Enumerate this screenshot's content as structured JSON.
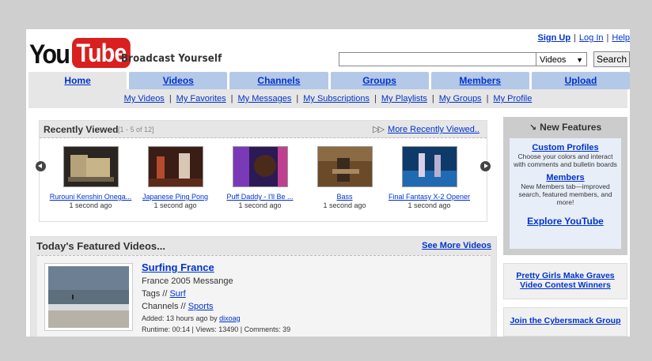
{
  "header": {
    "logo_left": "You",
    "logo_right": "Tube",
    "tagline": "Broadcast Yourself",
    "top_links": [
      "Sign Up",
      "Log In",
      "Help"
    ],
    "search": {
      "value": "",
      "select_value": "Videos",
      "button_label": "Search"
    }
  },
  "nav": {
    "tabs": [
      "Home",
      "Videos",
      "Channels",
      "Groups",
      "Members",
      "Upload"
    ],
    "active_tab": "Home",
    "sub_links": [
      "My Videos",
      "My Favorites",
      "My Messages",
      "My Subscriptions",
      "My Playlists",
      "My Groups",
      "My Profile"
    ]
  },
  "recent": {
    "title": "Recently Viewed",
    "range": "[1 - 5 of 12]",
    "more_label": "More Recently Viewed..",
    "items": [
      {
        "title": "Rurouni Kenshin Onega...",
        "time": "1 second ago"
      },
      {
        "title": "Japanese Ping Pong",
        "time": "1 second ago"
      },
      {
        "title": "Puff Daddy - I'll Be ...",
        "time": "1 second ago"
      },
      {
        "title": "Bass",
        "time": "1 second ago"
      },
      {
        "title": "Final Fantasy X-2 Opener",
        "time": "1 second ago"
      }
    ]
  },
  "featured": {
    "title": "Today's Featured Videos...",
    "more_label": "See More Videos",
    "video": {
      "title": "Surfing France",
      "description": "France 2005 Messange",
      "tags_label": "Tags //",
      "tags_value": "Surf",
      "channels_label": "Channels //",
      "channels_value": "Sports",
      "added_prefix": "Added: 13 hours ago by",
      "added_user": "dixoag",
      "stats": "Runtime: 00:14 | Views: 13490 | Comments: 39"
    }
  },
  "new_features": {
    "title": "New Features",
    "items": [
      {
        "link": "Custom Profiles",
        "text": "Choose your colors and interact with comments and bulletin boards"
      },
      {
        "link": "Members",
        "text": "New Members tab—improved search, featured members, and more!"
      }
    ],
    "explore_label": "Explore YouTube"
  },
  "side_links": {
    "contest_line1": "Pretty Girls Make Graves",
    "contest_line2": "Video Contest Winners",
    "cyber": "Join the Cybersmack Group"
  },
  "colors": {
    "accent": "#0033cc",
    "tab_bg": "#b4c8e8",
    "logo_red": "#d91f1f"
  }
}
